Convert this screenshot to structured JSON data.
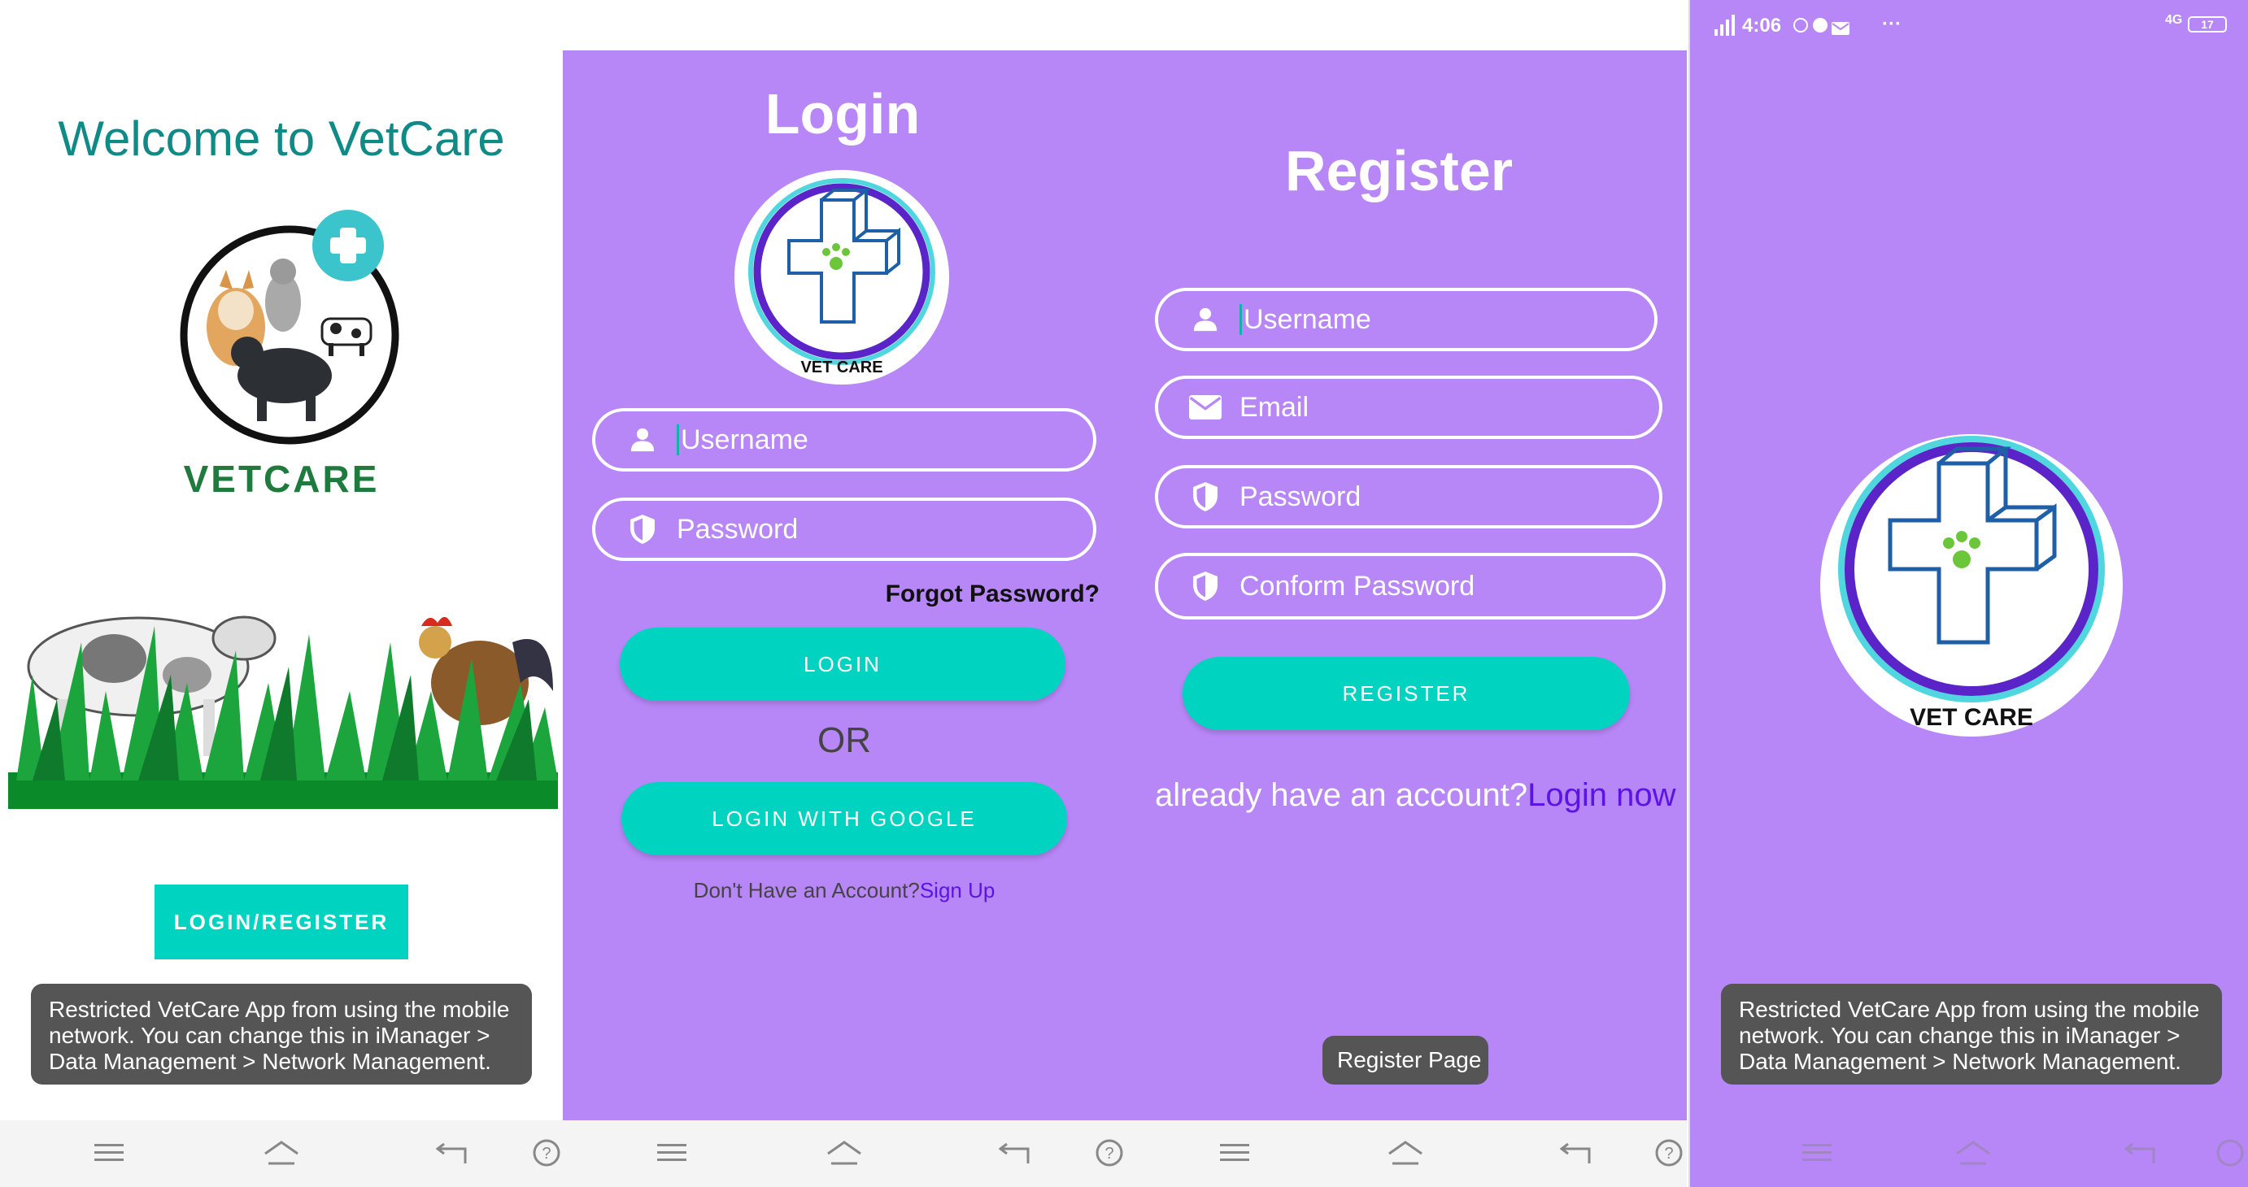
{
  "welcome": {
    "title": "Welcome to VetCare",
    "logo_text": "VETCARE",
    "button": "LOGIN/REGISTER",
    "toast": "Restricted VetCare App from using the mobile network. You can change this in iManager > Data Management > Network Management."
  },
  "login": {
    "title": "Login",
    "logo_caption": "VET CARE",
    "username_placeholder": "Username",
    "password_placeholder": "Password",
    "forgot": "Forgot Password?",
    "login_button": "LOGIN",
    "or": "OR",
    "google_button": "LOGIN WITH GOOGLE",
    "no_account": "Don't Have an Account?",
    "sign_up": "Sign Up"
  },
  "register": {
    "title": "Register",
    "username_placeholder": "Username",
    "email_placeholder": "Email",
    "password_placeholder": "Password",
    "confirm_placeholder": "Conform Password",
    "register_button": "REGISTER",
    "already": "already have an account?",
    "login_now": "Login now",
    "toast": "Register Page"
  },
  "splash": {
    "status_time": "4:06",
    "status_signal": "4G",
    "status_battery": "17",
    "status_more": "···",
    "logo_caption": "VET CARE",
    "toast": "Restricted VetCare App from using the mobile network. You can change this in iManager > Data Management > Network Management."
  },
  "colors": {
    "purple": "#b786f7",
    "teal": "#00d4c0",
    "title_teal": "#0f8a86",
    "link": "#5c14e6"
  }
}
